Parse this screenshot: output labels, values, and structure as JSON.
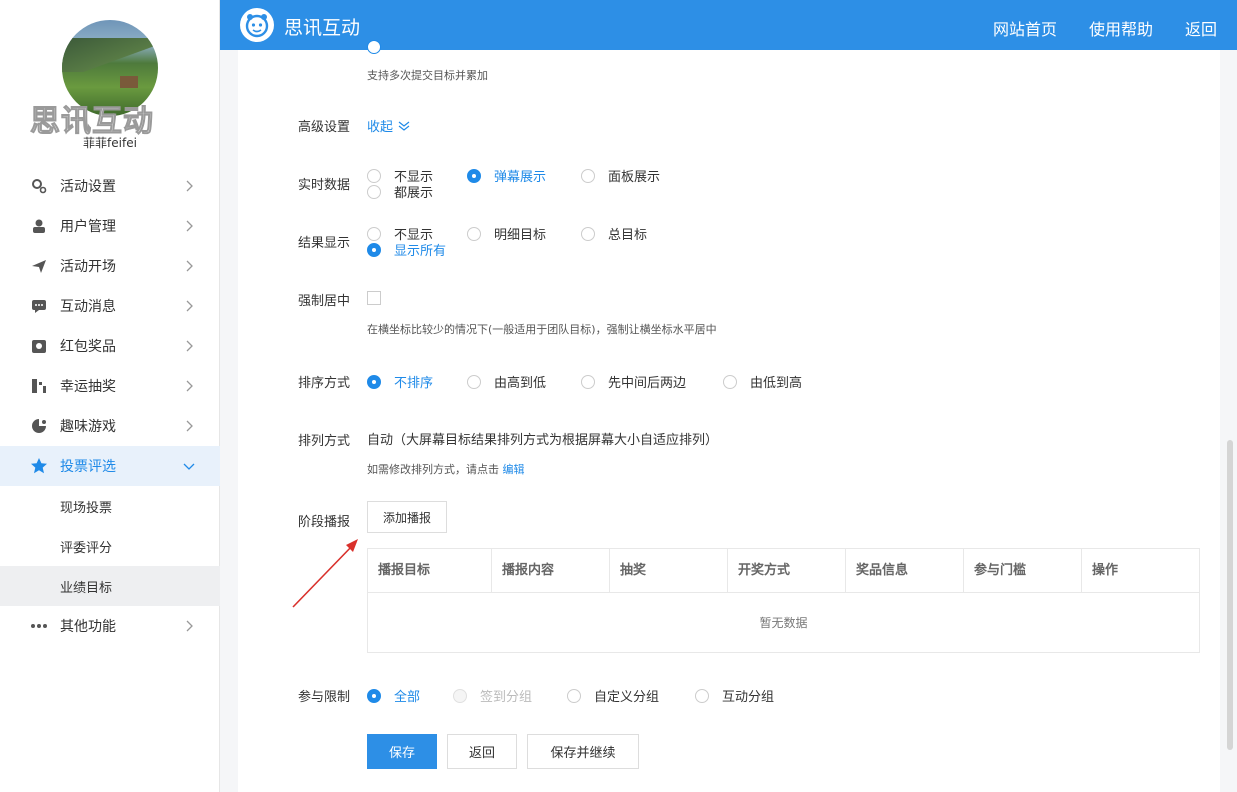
{
  "sidebar": {
    "watermark": "思讯互动",
    "username": "菲菲feifei",
    "menu": [
      {
        "label": "活动设置",
        "icon": "gear-icon"
      },
      {
        "label": "用户管理",
        "icon": "user-icon"
      },
      {
        "label": "活动开场",
        "icon": "paper-plane-icon"
      },
      {
        "label": "互动消息",
        "icon": "chat-icon"
      },
      {
        "label": "红包奖品",
        "icon": "gift-icon"
      },
      {
        "label": "幸运抽奖",
        "icon": "lottery-icon"
      },
      {
        "label": "趣味游戏",
        "icon": "game-icon"
      },
      {
        "label": "投票评选",
        "icon": "star-icon",
        "active": true
      },
      {
        "label": "其他功能",
        "icon": "more-icon"
      }
    ],
    "submenu": [
      "现场投票",
      "评委评分",
      "业绩目标"
    ]
  },
  "topbar": {
    "brand": "思讯互动",
    "links": [
      "网站首页",
      "使用帮助",
      "返回"
    ]
  },
  "form": {
    "top_help": "支持多次提交目标并累加",
    "advanced": {
      "label": "高级设置",
      "toggle": "收起"
    },
    "realtime": {
      "label": "实时数据",
      "options": [
        "不显示",
        "弹幕展示",
        "面板展示",
        "都展示"
      ],
      "selected": "弹幕展示"
    },
    "result": {
      "label": "结果显示",
      "options": [
        "不显示",
        "明细目标",
        "总目标",
        "显示所有"
      ],
      "selected": "显示所有"
    },
    "center": {
      "label": "强制居中",
      "help": "在横坐标比较少的情况下(一般适用于团队目标)，强制让横坐标水平居中"
    },
    "sort": {
      "label": "排序方式",
      "options": [
        "不排序",
        "由高到低",
        "先中间后两边",
        "由低到高"
      ],
      "selected": "不排序"
    },
    "arrange": {
      "label": "排列方式",
      "value": "自动（大屏幕目标结果排列方式为根据屏幕大小自适应排列）",
      "help_prefix": "如需修改排列方式，请点击",
      "help_link": "编辑"
    },
    "stage": {
      "label": "阶段播报",
      "add_button": "添加播报"
    },
    "table": {
      "columns": [
        "播报目标",
        "播报内容",
        "抽奖",
        "开奖方式",
        "奖品信息",
        "参与门槛",
        "操作"
      ],
      "empty": "暂无数据"
    },
    "limit": {
      "label": "参与限制",
      "options": [
        "全部",
        "签到分组",
        "自定义分组",
        "互动分组"
      ],
      "selected": "全部",
      "disabled": "签到分组"
    },
    "buttons": {
      "save": "保存",
      "back": "返回",
      "save_continue": "保存并继续"
    }
  },
  "colors": {
    "accent": "#2d8fe6",
    "link": "#1f8ae8",
    "annotation_arrow": "#d9302b"
  }
}
